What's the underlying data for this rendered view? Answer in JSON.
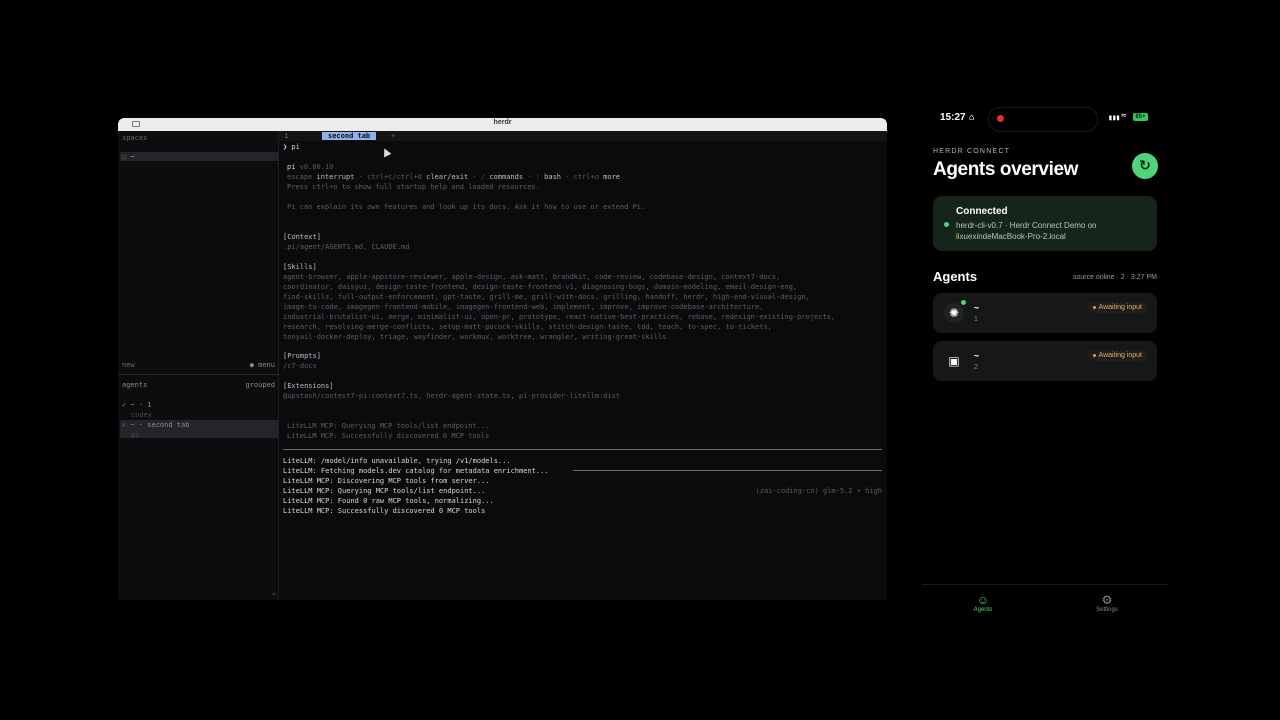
{
  "window": {
    "title": "herdr"
  },
  "left_panel": {
    "spaces_label": "spaces",
    "space_item": "◌ ~",
    "new_label": "new",
    "menu_label": "● menu",
    "agents_label": "agents",
    "grouped_label": "grouped",
    "agents": [
      {
        "line1": "✓ ~ · 1",
        "line2": "codex"
      },
      {
        "line1": "✓ ~ · second tab",
        "line2": "pi"
      }
    ],
    "collapse_glyph": "«"
  },
  "tabs": [
    {
      "label": "1"
    },
    {
      "label": "second tab"
    },
    {
      "label": "+"
    }
  ],
  "terminal": {
    "prompt": "❯ pi",
    "version_name": "pi",
    "version_num": "v0.80.10",
    "help_line": [
      {
        "t": "escape ",
        "c": "dim"
      },
      {
        "t": "interrupt",
        "c": "hl"
      },
      {
        "t": " · ctrl+c/ctrl+d ",
        "c": "dim"
      },
      {
        "t": "clear/exit",
        "c": "hl"
      },
      {
        "t": " · / ",
        "c": "dim"
      },
      {
        "t": "commands",
        "c": "hl"
      },
      {
        "t": " · ! ",
        "c": "dim"
      },
      {
        "t": "bash",
        "c": "hl"
      },
      {
        "t": " · ctrl+o ",
        "c": "dim"
      },
      {
        "t": "more",
        "c": "hl"
      }
    ],
    "press_line": "Press ctrl+o to show full startup help and loaded resources.",
    "explain_line": "Pi can explain its own features and look up its docs. Ask it how to use or extend Pi.",
    "context_header": "[Context]",
    "context_line": "  .pi/agent/AGENTS.md, CLAUDE.md",
    "skills_header": "[Skills]",
    "skills_lines": [
      "  agent-browser, apple-appstore-reviewer, apple-design, ask-matt, brandkit, code-review, codebase-design, context7-docs,",
      "coordinator, daisyui, design-taste-frontend, design-taste-frontend-v1, diagnosing-bugs, domain-modeling, email-design-eng,",
      "find-skills, full-output-enforcement, gpt-taste, grill-me, grill-with-docs, grilling, handoff, herdr, high-end-visual-design,",
      "image-to-code, imagegen-frontend-mobile, imagegen-frontend-web, implement, improve, improve-codebase-architecture,",
      "industrial-brutalist-ui, merge, minimalist-ui, open-pr, prototype, react-native-best-practices, rebase, redesign-existing-projects,",
      "research, resolving-merge-conflicts, setup-matt-pocock-skills, stitch-design-taste, tdd, teach, to-spec, to-tickets,",
      "tonyail-docker-deploy, triage, wayfinder, workmux, worktree, wrangler, writing-great-skills"
    ],
    "prompts_header": "[Prompts]",
    "prompts_line": "  /c7-docs",
    "ext_header": "[Extensions]",
    "ext_line": "  @upstash/context7-pi:context7.ts, herdr-agent-state.ts, pi-provider-litellm:dist",
    "mcp_dim_lines": [
      " LiteLLM MCP: Querying MCP tools/list endpoint...",
      " LiteLLM MCP: Successfully discovered 0 MCP tools"
    ],
    "log_lines": [
      "LiteLLM: /model/info unavailable, trying /v1/models...",
      "LiteLLM: Fetching models.dev catalog for metadata enrichment...",
      "LiteLLM MCP: Discovering MCP tools from server...",
      "LiteLLM MCP: Querying MCP tools/list endpoint...",
      "LiteLLM MCP: Found 0 raw MCP tools, normalizing...",
      "LiteLLM MCP: Successfully discovered 0 MCP tools"
    ],
    "model_status": "(zai-coding-cn) glm-5.2 • high"
  },
  "phone": {
    "time": "15:27",
    "battery": "85+",
    "eyebrow": "HERDR CONNECT",
    "title": "Agents overview",
    "connection": {
      "title": "Connected",
      "subtitle": "herdr-cli-v0.7 · Herdr Connect Demo on lixuexindeMacBook-Pro-2.local"
    },
    "agents_title": "Agents",
    "agents_meta": "source online · 2 · 3:27 PM",
    "agents": [
      {
        "name": "~",
        "index": "1",
        "status": "Awaiting input",
        "icon": "openai-icon"
      },
      {
        "name": "~",
        "index": "2",
        "status": "Awaiting input",
        "icon": "pi-icon"
      }
    ],
    "tabbar": [
      {
        "label": "Agents",
        "icon": "people-icon",
        "color": "#4ed47a"
      },
      {
        "label": "Settings",
        "icon": "gear-icon",
        "color": "#8a8a8a"
      }
    ]
  }
}
